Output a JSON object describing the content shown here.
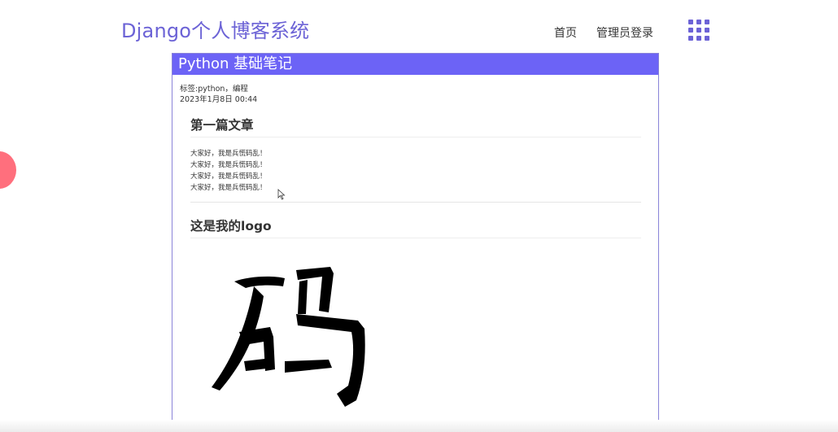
{
  "header": {
    "site_title": "Django个人博客系统",
    "nav": {
      "home_label": "首页",
      "admin_login_label": "管理员登录"
    },
    "menu_icon": "grid-menu-icon"
  },
  "article": {
    "title": "Python 基础笔记",
    "tags_text": "标签:python，编程",
    "date_text": "2023年1月8日 00:44",
    "sections": [
      {
        "heading": "第一篇文章",
        "lines": [
          "大家好，我是兵慌码乱！",
          "大家好，我是兵慌码乱！",
          "大家好，我是兵慌码乱！",
          "大家好，我是兵慌码乱！"
        ]
      },
      {
        "heading": "这是我的logo"
      }
    ],
    "logo_text": "码"
  },
  "colors": {
    "accent": "#6c63f6",
    "title_purple": "#6c63d6",
    "decor_pink": "#ff6f7d"
  }
}
